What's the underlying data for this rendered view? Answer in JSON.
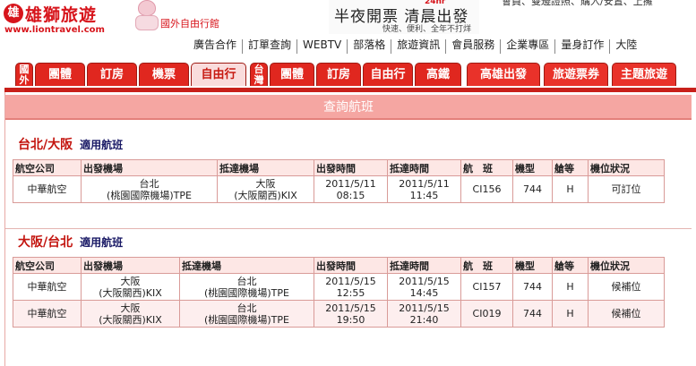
{
  "header": {
    "logo_mark": "雄",
    "logo_name": "雄獅旅遊",
    "logo_url": "www.liontravel.com",
    "site_section": "國外自由行館",
    "promo_main": "半夜開票  清晨出發",
    "promo_tag": "24hr",
    "promo_sub": "快速、便利、全年不打烊",
    "top_cut_text": "會員、雙邊證照、購入/安置、上擁"
  },
  "toplinks": [
    "廣告合作",
    "訂單查詢",
    "WEBTV",
    "部落格",
    "旅遊資訊",
    "會員服務",
    "企業專區",
    "量身訂作",
    "大陸"
  ],
  "tabs": {
    "group_abroad": "國外",
    "abroad": [
      "團體",
      "訂房",
      "機票",
      "自由行"
    ],
    "group_taiwan": "台灣",
    "taiwan": [
      "團體",
      "訂房",
      "自由行",
      "高鐵"
    ],
    "extra": [
      "高雄出發",
      "旅遊票券",
      "主題旅遊"
    ],
    "selected": "自由行"
  },
  "panel": {
    "title": "查詢航班"
  },
  "columns": [
    "航空公司",
    "出發機場",
    "抵達機場",
    "出發時間",
    "抵達時間",
    "航　班",
    "機型",
    "艙等",
    "機位狀況"
  ],
  "routes": [
    {
      "title": "台北/大阪",
      "applicable": "適用航班",
      "flights": [
        {
          "airline": "中華航空",
          "dep_city": "台北",
          "dep_airport": "(桃園國際機場)TPE",
          "arr_city": "大阪",
          "arr_airport": "(大阪關西)KIX",
          "dep_date": "2011/5/11",
          "dep_time": "08:15",
          "arr_date": "2011/5/11",
          "arr_time": "11:45",
          "flight": "CI156",
          "aircraft": "744",
          "class": "H",
          "status": "可訂位"
        }
      ]
    },
    {
      "title": "大阪/台北",
      "applicable": "適用航班",
      "flights": [
        {
          "airline": "中華航空",
          "dep_city": "大阪",
          "dep_airport": "(大阪關西)KIX",
          "arr_city": "台北",
          "arr_airport": "(桃園國際機場)TPE",
          "dep_date": "2011/5/15",
          "dep_time": "12:55",
          "arr_date": "2011/5/15",
          "arr_time": "14:45",
          "flight": "CI157",
          "aircraft": "744",
          "class": "H",
          "status": "候補位"
        },
        {
          "airline": "中華航空",
          "dep_city": "大阪",
          "dep_airport": "(大阪關西)KIX",
          "arr_city": "台北",
          "arr_airport": "(桃園國際機場)TPE",
          "dep_date": "2011/5/15",
          "dep_time": "19:50",
          "arr_date": "2011/5/15",
          "arr_time": "21:40",
          "flight": "CI019",
          "aircraft": "744",
          "class": "H",
          "status": "候補位"
        }
      ]
    }
  ],
  "colors": {
    "brand_red": "#d7141b",
    "tab_red": "#e0271f",
    "panel_pink": "#f5a6a2",
    "header_cell": "#fde7e5"
  }
}
